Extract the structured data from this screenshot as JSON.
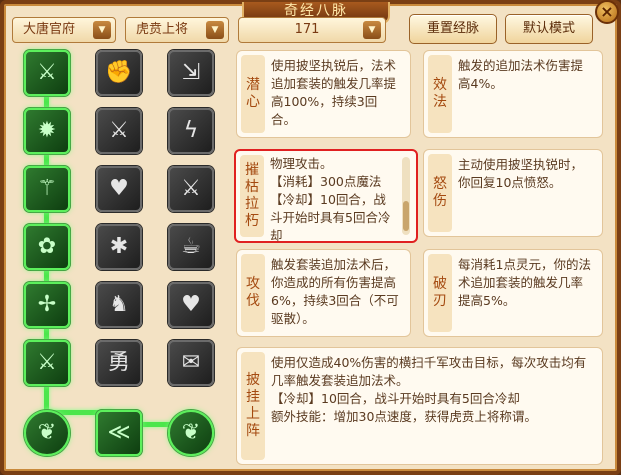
{
  "window": {
    "title": "奇经八脉",
    "close_label": "×"
  },
  "toolbar": {
    "sect": "大唐官府",
    "school": "虎贲上将",
    "points": "171",
    "reset_label": "重置经脉",
    "default_label": "默认模式"
  },
  "skills": {
    "icons": [
      "⚔",
      "✊",
      "⇲",
      "✹",
      "⚔",
      "ϟ",
      "⚚",
      "♥",
      "⚔",
      "✿",
      "✱",
      "☕",
      "✢",
      "♞",
      "♥",
      "⚔",
      "勇",
      "✉",
      "❦",
      "≪",
      "❦"
    ]
  },
  "cards": [
    {
      "name": "潜\n心",
      "desc": "使用披坚执锐后，法术追加套装的触发几率提高100%，持续3回合。"
    },
    {
      "name": "效\n法",
      "desc": "触发的追加法术伤害提高4%。"
    },
    {
      "name": "摧\n枯\n拉\n朽",
      "desc": "物理攻击。\n【消耗】300点魔法\n【冷却】10回合，战斗开始时具有5回合冷却"
    },
    {
      "name": "怒\n伤",
      "desc": "主动使用披坚执锐时，你回复10点愤怒。"
    },
    {
      "name": "攻\n伐",
      "desc": "触发套装追加法术后，你造成的所有伤害提高6%，持续3回合（不可驱散）。"
    },
    {
      "name": "破\n刃",
      "desc": "每消耗1点灵元，你的法术追加套装的触发几率提高5%。"
    },
    {
      "name": "披\n挂\n上\n阵",
      "desc": "使用仅造成40%伤害的横扫千军攻击目标，每次攻击均有几率触发套装追加法术。\n【冷却】10回合，战斗开始时具有5回合冷却\n额外技能：增加30点速度，获得虎贲上将称谓。"
    }
  ],
  "colors": {
    "active_border": "#5cf05c",
    "selected_border": "#e02020"
  }
}
